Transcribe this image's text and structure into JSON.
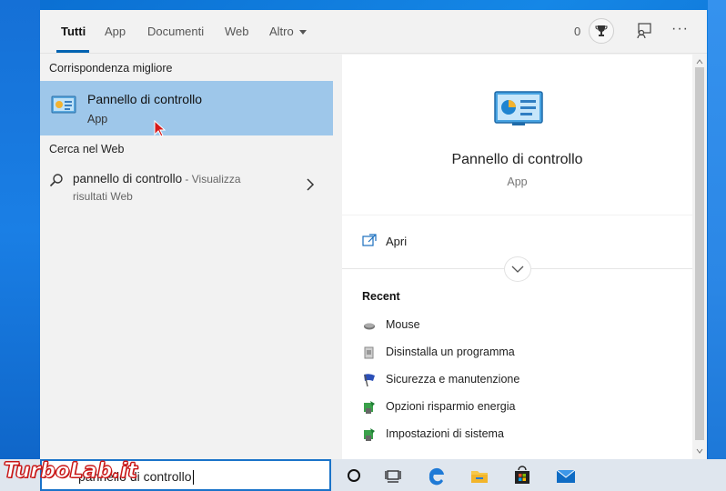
{
  "tabs": [
    {
      "label": "Tutti",
      "active": true
    },
    {
      "label": "App"
    },
    {
      "label": "Documenti"
    },
    {
      "label": "Web"
    },
    {
      "label": "Altro"
    }
  ],
  "header": {
    "points": "0",
    "trophy_icon": "trophy-icon",
    "feedback_icon": "feedback-icon",
    "more_label": "···"
  },
  "left": {
    "best_match_heading": "Corrispondenza migliore",
    "best_match": {
      "title": "Pannello di controllo",
      "type": "App",
      "icon": "control-panel-icon"
    },
    "web_heading": "Cerca nel Web",
    "web_result": {
      "query": "pannello di controllo",
      "suffix": " - Visualizza",
      "line2": "risultati Web"
    }
  },
  "preview": {
    "title": "Pannello di controllo",
    "type": "App",
    "open_label": "Apri",
    "recent_heading": "Recent",
    "recent": [
      {
        "label": "Mouse",
        "icon": "mouse-icon"
      },
      {
        "label": "Disinstalla un programma",
        "icon": "uninstall-icon"
      },
      {
        "label": "Sicurezza e manutenzione",
        "icon": "security-flag-icon"
      },
      {
        "label": "Opzioni risparmio energia",
        "icon": "power-options-icon"
      },
      {
        "label": "Impostazioni di sistema",
        "icon": "system-settings-icon"
      }
    ]
  },
  "taskbar": {
    "search_text": "pannello di controllo",
    "watermark": "TurboLab.it"
  },
  "colors": {
    "selected": "#9ec7ea",
    "accent": "#0063b1",
    "taskbar": "#dfe6ee"
  }
}
